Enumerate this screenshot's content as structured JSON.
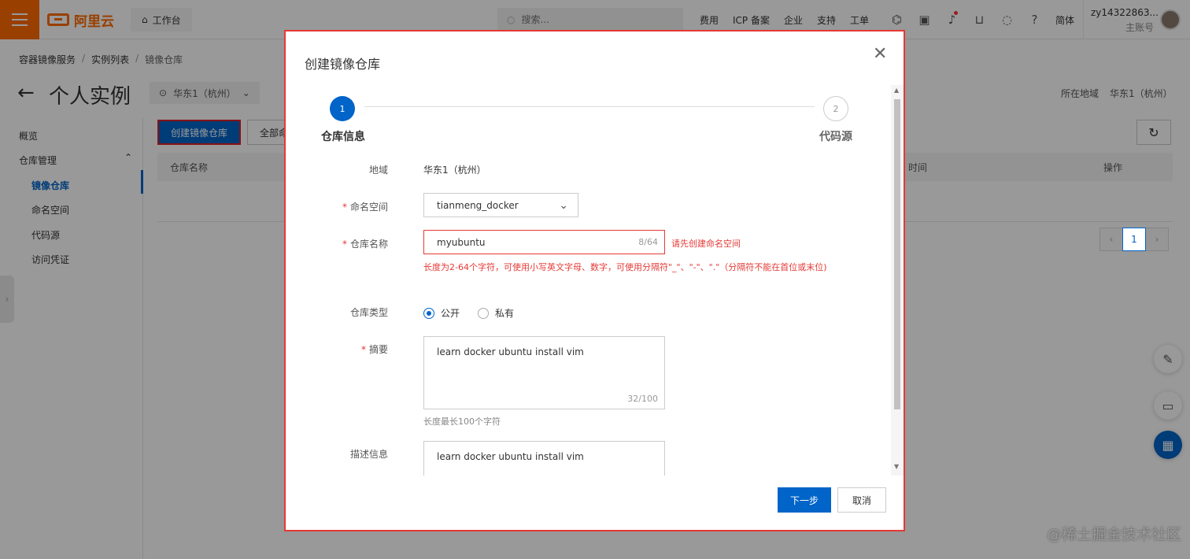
{
  "topbar": {
    "logo_text": "阿里云",
    "workbench_label": "工作台",
    "search_placeholder": "搜索...",
    "nav_links": [
      "费用",
      "ICP 备案",
      "企业",
      "支持",
      "工单"
    ],
    "icons": [
      "code-icon",
      "terminal-icon",
      "bell-icon",
      "cart-icon",
      "lightbulb-icon",
      "help-icon"
    ],
    "lang": "简体",
    "username": "zy14322863...",
    "account_type": "主账号",
    "brand_color": "#ff6a00"
  },
  "breadcrumb": [
    "容器镜像服务",
    "实例列表",
    "镜像仓库"
  ],
  "header": {
    "title": "个人实例",
    "region": "华东1（杭州）",
    "region_right_label": "所在地域",
    "region_right_value": "华东1（杭州）"
  },
  "leftnav": {
    "overview": "概览",
    "repo_mgmt": "仓库管理",
    "items": [
      "镜像仓库",
      "命名空间",
      "代码源",
      "访问凭证"
    ]
  },
  "main": {
    "create_button": "创建镜像仓库",
    "all_filter": "全部命",
    "table_headers": {
      "name": "仓库名称",
      "time": "时间",
      "action": "操作"
    },
    "pagination_current": "1"
  },
  "dialog": {
    "title": "创建镜像仓库",
    "steps": [
      {
        "num": "1",
        "label": "仓库信息"
      },
      {
        "num": "2",
        "label": "代码源"
      }
    ],
    "region_label": "地域",
    "region_value": "华东1（杭州）",
    "namespace_label": "命名空间",
    "namespace_value": "tianmeng_docker",
    "repo_name_label": "仓库名称",
    "repo_name_value": "myubuntu",
    "repo_name_count": "8/64",
    "repo_name_error": "请先创建命名空间",
    "repo_name_help": "长度为2-64个字符，可使用小写英文字母、数字，可使用分隔符\"_\"、\"-\"、\".\"（分隔符不能在首位或末位)",
    "repo_type_label": "仓库类型",
    "repo_type_public": "公开",
    "repo_type_private": "私有",
    "summary_label": "摘要",
    "summary_value": "learn docker ubuntu install vim",
    "summary_count": "32/100",
    "summary_hint": "长度最长100个字符",
    "description_label": "描述信息",
    "description_value": "learn docker ubuntu install vim",
    "next_button": "下一步",
    "cancel_button": "取消",
    "accent_color": "#0064c8",
    "error_color": "#e53935"
  },
  "watermark": "@稀土掘金技术社区"
}
